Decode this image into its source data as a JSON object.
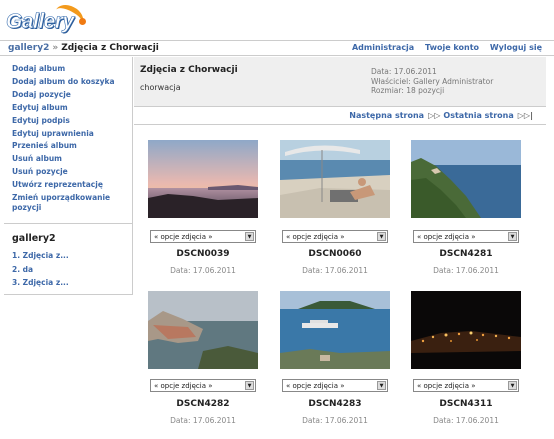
{
  "logo": {
    "text": "Gallery"
  },
  "breadcrumb": {
    "root": "gallery2",
    "separator": "»",
    "current": "Zdjęcia z Chorwacji"
  },
  "top_links": [
    "Administracja",
    "Twoje konto",
    "Wyloguj się"
  ],
  "sidebar": {
    "actions": [
      "Dodaj album",
      "Dodaj album do koszyka",
      "Dodaj pozycje",
      "Edytuj album",
      "Edytuj podpis",
      "Edytuj uprawnienia",
      "Przenieś album",
      "Usuń album",
      "Usuń pozycje",
      "Utwórz reprezentację",
      "Zmień uporządkowanie pozycji"
    ],
    "title": "gallery2",
    "list": [
      "1. Zdjęcia z...",
      "2. da",
      "3. Zdjęcia z..."
    ]
  },
  "album": {
    "title": "Zdjęcia z Chorwacji",
    "description": "chorwacja",
    "date": "Data: 17.06.2011",
    "owner": "Właściciel: Gallery Administrator",
    "size": "Rozmiar: 18 pozycji"
  },
  "nav": {
    "next": "Następna strona",
    "last": "Ostatnia strona"
  },
  "items": [
    {
      "caption": "DSCN0039",
      "date": "Data: 17.06.2011",
      "option": "« opcje zdjęcia »",
      "scene": "sunset-sea"
    },
    {
      "caption": "DSCN0060",
      "date": "Data: 17.06.2011",
      "option": "« opcje zdjęcia »",
      "scene": "beach-umbrella"
    },
    {
      "caption": "DSCN4281",
      "date": "Data: 17.06.2011",
      "option": "« opcje zdjęcia »",
      "scene": "coastline"
    },
    {
      "caption": "DSCN4282",
      "date": "Data: 17.06.2011",
      "option": "« opcje zdjęcia »",
      "scene": "old-town"
    },
    {
      "caption": "DSCN4283",
      "date": "Data: 17.06.2011",
      "option": "« opcje zdjęcia »",
      "scene": "island-ship"
    },
    {
      "caption": "DSCN4311",
      "date": "Data: 17.06.2011",
      "option": "« opcje zdjęcia »",
      "scene": "night-lights"
    }
  ]
}
